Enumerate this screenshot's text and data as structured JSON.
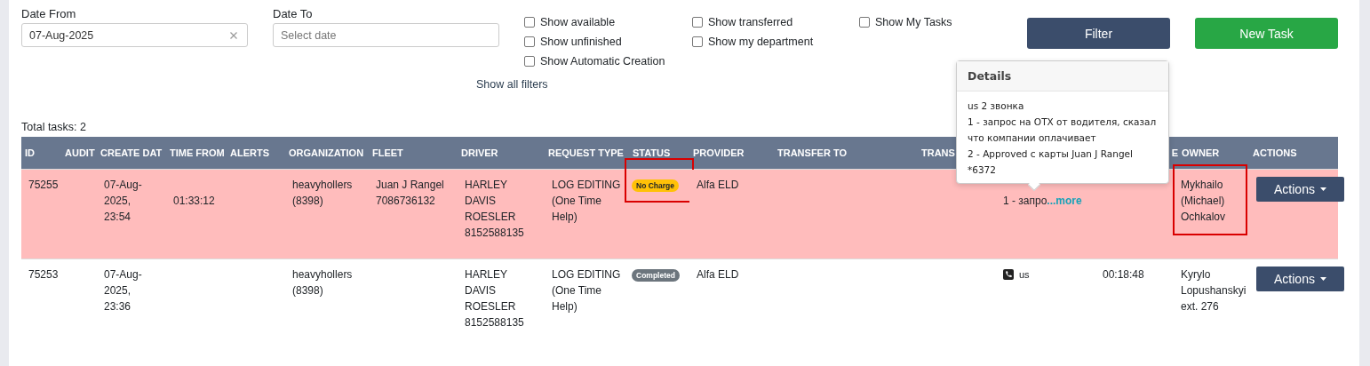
{
  "filters": {
    "date_from": {
      "label": "Date From",
      "value": "07-Aug-2025"
    },
    "date_to": {
      "label": "Date To",
      "placeholder": "Select date"
    },
    "checkboxes": [
      [
        {
          "label": "Show available",
          "checked": false
        },
        {
          "label": "Show unfinished",
          "checked": false
        },
        {
          "label": "Show Automatic Creation",
          "checked": false
        }
      ],
      [
        {
          "label": "Show transferred",
          "checked": false
        },
        {
          "label": "Show my department",
          "checked": false
        }
      ],
      [
        {
          "label": "Show My Tasks",
          "checked": false
        }
      ]
    ],
    "filter_button": "Filter",
    "new_task_button": "New Task",
    "show_all_filters": "Show all filters"
  },
  "total_tasks": "Total tasks: 2",
  "table": {
    "columns": [
      "ID",
      "AUDIT",
      "CREATE DAT",
      "TIME FROM",
      "ALERTS",
      "ORGANIZATION",
      "FLEET",
      "DRIVER",
      "REQUEST TYPE",
      "STATUS",
      "PROVIDER",
      "TRANSFER TO",
      "TRANS",
      "",
      "E",
      "OWNER",
      "ACTIONS"
    ],
    "rows": [
      {
        "highlighted": true,
        "cells": [
          {
            "kind": "text",
            "text": "75255"
          },
          {
            "kind": "empty"
          },
          {
            "kind": "text",
            "text": "07-Aug-2025, 23:54"
          },
          {
            "kind": "text",
            "text": "01:33:12"
          },
          {
            "kind": "empty"
          },
          {
            "kind": "text",
            "text": " heavyhollers (8398)"
          },
          {
            "kind": "text",
            "text": "Juan J Rangel 7086736132"
          },
          {
            "kind": "text",
            "text": "HARLEY DAVIS ROESLER 8152588135"
          },
          {
            "kind": "text",
            "text": " LOG EDITING (One Time Help)"
          },
          {
            "kind": "badge",
            "text": "No Charge",
            "color": "#ffc107",
            "marked": true
          },
          {
            "kind": "text",
            "text": "Alfa ELD"
          },
          {
            "kind": "empty"
          },
          {
            "kind": "empty"
          },
          {
            "kind": "note",
            "text": "1 - запро",
            "link": "...more"
          },
          {
            "kind": "empty"
          },
          {
            "kind": "text",
            "text": "Mykhailo (Michael) Ochkalov",
            "marked": true
          },
          {
            "kind": "actions",
            "text": "Actions"
          }
        ]
      },
      {
        "highlighted": false,
        "cells": [
          {
            "kind": "text",
            "text": "75253"
          },
          {
            "kind": "empty"
          },
          {
            "kind": "text",
            "text": "07-Aug-2025, 23:36"
          },
          {
            "kind": "empty"
          },
          {
            "kind": "empty"
          },
          {
            "kind": "text",
            "text": " heavyhollers (8398)"
          },
          {
            "kind": "empty"
          },
          {
            "kind": "text",
            "text": "HARLEY DAVIS ROESLER 8152588135"
          },
          {
            "kind": "text",
            "text": " LOG EDITING (One Time Help)"
          },
          {
            "kind": "badge",
            "text": "Completed",
            "color": "#6c757d",
            "marked": false
          },
          {
            "kind": "text",
            "text": "Alfa ELD"
          },
          {
            "kind": "empty"
          },
          {
            "kind": "empty"
          },
          {
            "kind": "call",
            "text": "us"
          },
          {
            "kind": "text",
            "text": "00:18:48"
          },
          {
            "kind": "text",
            "text": "Kyrylo Lopushanskyi ext. 276"
          },
          {
            "kind": "actions",
            "text": "Actions"
          }
        ]
      }
    ]
  },
  "popover": {
    "title": "Details",
    "lines": [
      "us 2 звонка",
      "1 - запрос на ОТХ от водителя, сказал что компании оплачивает",
      "2 - Approved с карты Juan J Rangel *6372"
    ]
  }
}
